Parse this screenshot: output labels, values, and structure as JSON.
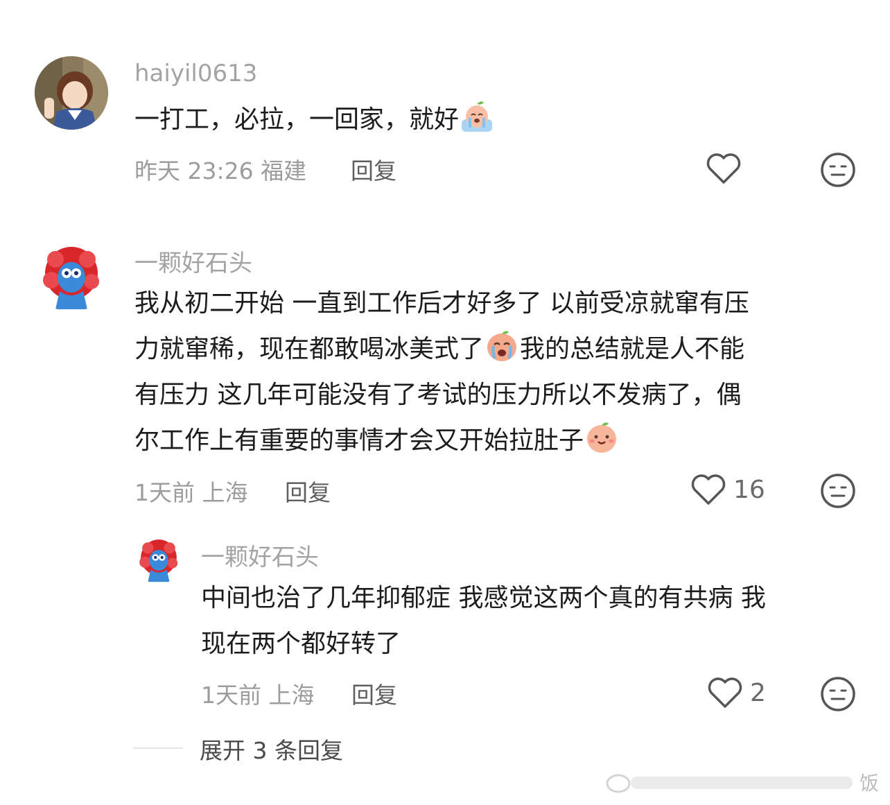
{
  "comments": [
    {
      "username": "haiyil0613",
      "text_before": "一打工，必拉，一回家，就好",
      "emoji": "crying-peach-emoji",
      "time": "昨天 23:26",
      "location": "福建",
      "reply_label": "回复",
      "like_count": ""
    },
    {
      "username": "一颗好石头",
      "line1": "我从初二开始 一直到工作后才好多了 以前受凉就窜有压",
      "line2_before": "力就窜稀，现在都敢喝冰美式了",
      "line2_emoji": "crying-peach-emoji",
      "line2_after": "我的总结就是人不能",
      "line3": "有压力 这几年可能没有了考试的压力所以不发病了，偶",
      "line4": "尔工作上有重要的事情才会又开始拉肚子",
      "line4_emoji": "smiling-peach-emoji",
      "time": "1天前",
      "location": "上海",
      "reply_label": "回复",
      "like_count": "16"
    },
    {
      "username": "一颗好石头",
      "line1": "中间也治了几年抑郁症 我感觉这两个真的有共病 我",
      "line2": "现在两个都好转了",
      "time": "1天前",
      "location": "上海",
      "reply_label": "回复",
      "like_count": "2"
    }
  ],
  "expand_label": "展开 3 条回复",
  "watermark_text": "饭",
  "colors": {
    "username": "#a3a3a3",
    "text": "#1c1c1c",
    "meta": "#9c9c9c",
    "icon": "#555555"
  }
}
